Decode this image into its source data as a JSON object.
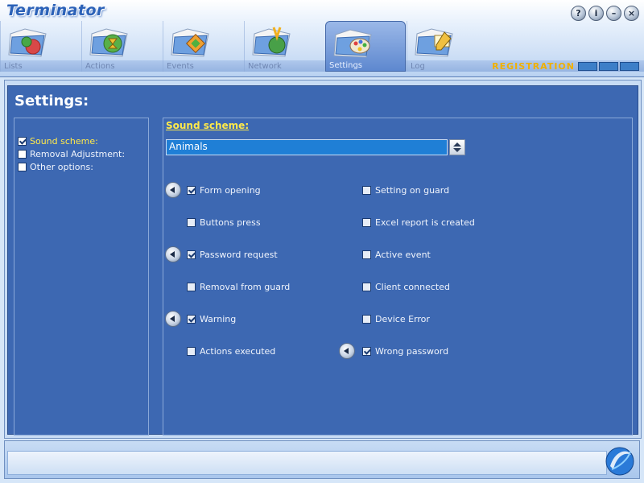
{
  "app": {
    "title": "Terminator"
  },
  "window_buttons": [
    {
      "name": "help-button",
      "icon": "help-icon",
      "glyph": "?"
    },
    {
      "name": "info-button",
      "icon": "info-icon",
      "glyph": "i"
    },
    {
      "name": "minimize-button",
      "icon": "minimize-icon",
      "glyph": "–"
    },
    {
      "name": "close-button",
      "icon": "close-icon",
      "glyph": "×"
    }
  ],
  "tabs": [
    {
      "label": "Lists",
      "icon": "lists-folder-icon",
      "color": "#d44040"
    },
    {
      "label": "Actions",
      "icon": "actions-folder-icon",
      "color": "#e0a020"
    },
    {
      "label": "Events",
      "icon": "events-folder-icon",
      "color": "#e8a030"
    },
    {
      "label": "Network",
      "icon": "network-folder-icon",
      "color": "#40a040"
    },
    {
      "label": "Settings",
      "icon": "settings-folder-icon",
      "color": "#e8e040",
      "active": true
    },
    {
      "label": "Log",
      "icon": "log-folder-icon",
      "color": "#e0c040"
    }
  ],
  "registration": "REGISTRATION",
  "page": {
    "title": "Settings:"
  },
  "nav": [
    {
      "label": "Sound scheme:",
      "checked": true,
      "active": true
    },
    {
      "label": "Removal Adjustment:",
      "checked": false,
      "active": false
    },
    {
      "label": "Other options:",
      "checked": false,
      "active": false
    }
  ],
  "sound": {
    "section_title": "Sound scheme:",
    "scheme_value": "Animals",
    "options": [
      {
        "label": "Form opening",
        "checked": true,
        "play": true
      },
      {
        "label": "Setting on guard",
        "checked": false,
        "play": false
      },
      {
        "label": "Buttons press",
        "checked": false,
        "play": false
      },
      {
        "label": "Excel report is created",
        "checked": false,
        "play": false
      },
      {
        "label": "Password request",
        "checked": true,
        "play": true
      },
      {
        "label": "Active event",
        "checked": false,
        "play": false
      },
      {
        "label": "Removal from guard",
        "checked": false,
        "play": false
      },
      {
        "label": "Client connected",
        "checked": false,
        "play": false
      },
      {
        "label": "Warning",
        "checked": true,
        "play": true
      },
      {
        "label": "Device Error",
        "checked": false,
        "play": false
      },
      {
        "label": "Actions executed",
        "checked": false,
        "play": false
      },
      {
        "label": "Wrong password",
        "checked": true,
        "play": true
      }
    ]
  },
  "colors": {
    "accent": "#ffe94a",
    "panel": "#3d68b2",
    "registration": "#f0b000"
  }
}
